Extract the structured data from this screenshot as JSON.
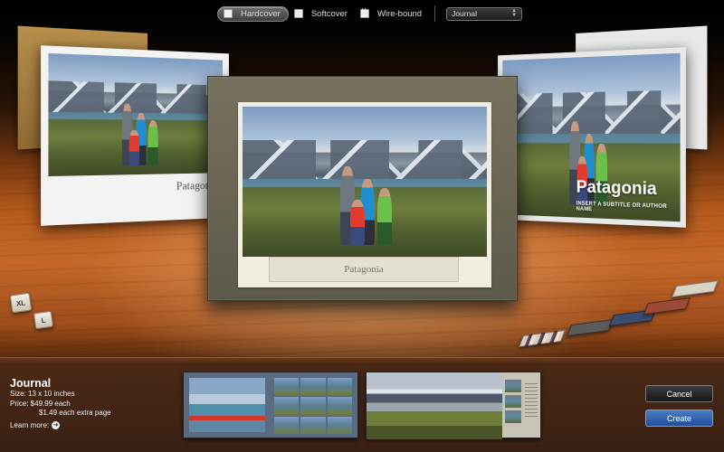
{
  "toolbar": {
    "options": [
      {
        "label": "Hardcover",
        "selected": true,
        "icon": "hardcover-book-icon"
      },
      {
        "label": "Softcover",
        "selected": false,
        "icon": "softcover-book-icon"
      },
      {
        "label": "Wire-bound",
        "selected": false,
        "icon": "wire-bound-book-icon"
      }
    ],
    "theme_select": {
      "value": "Journal"
    }
  },
  "books": {
    "left_title": "Patagonia",
    "right_title": "Patagonia",
    "right_subtitle": "INSERT A SUBTITLE OR AUTHOR NAME",
    "center_title": "Patagonia"
  },
  "sizes": {
    "xl": "XL",
    "l": "L"
  },
  "swatches": [
    "multi-stripe",
    "#5b5b5b",
    "#3b4d6e",
    "#9c4a37",
    "#d9d3c6"
  ],
  "info": {
    "theme_name": "Journal",
    "size_line": "Size: 13 x 10 inches",
    "price_line": "Price: $49.99 each",
    "extra_line": "$1.49 each extra page",
    "learn_more": "Learn more:"
  },
  "buttons": {
    "cancel": "Cancel",
    "create": "Create"
  },
  "colors": {
    "accent_create": "#2f62b0",
    "wood": "#c6682a"
  }
}
